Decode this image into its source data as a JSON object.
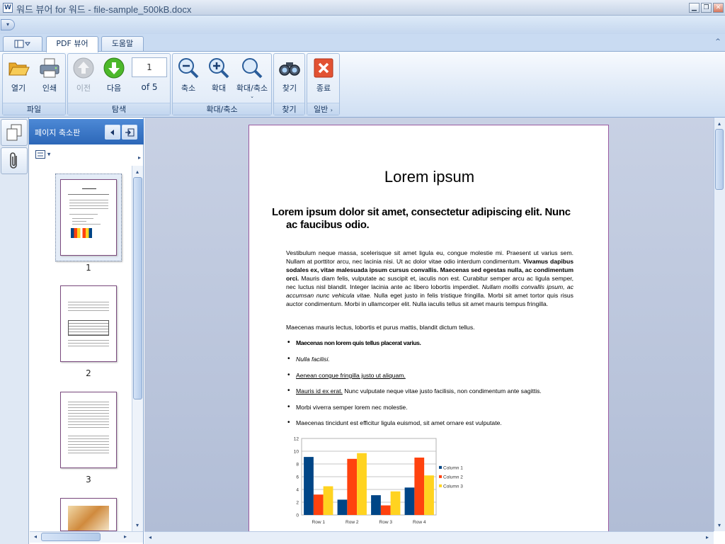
{
  "window": {
    "title": "워드 뷰어 for 워드 - file-sample_500kB.docx",
    "app_icon": "document-icon",
    "controls": [
      "minimize-icon",
      "restore-icon",
      "close-icon"
    ]
  },
  "tabs": [
    {
      "label": "PDF 뷰어",
      "active": true
    },
    {
      "label": "도움말",
      "active": false
    }
  ],
  "ribbon": {
    "groups": [
      {
        "label": "파일",
        "buttons": [
          {
            "label": "열기",
            "icon": "folder-open-icon"
          },
          {
            "label": "인쇄",
            "icon": "printer-icon"
          }
        ]
      },
      {
        "label": "탐색",
        "buttons": [
          {
            "label": "이전",
            "icon": "arrow-up-icon",
            "disabled": true
          },
          {
            "label": "다음",
            "icon": "arrow-down-icon"
          }
        ]
      },
      {
        "label": "확대/축소",
        "buttons": [
          {
            "label": "축소",
            "icon": "zoom-out-icon"
          },
          {
            "label": "확대",
            "icon": "zoom-in-icon"
          },
          {
            "label": "확대/축소",
            "icon": "zoom-icon"
          }
        ]
      },
      {
        "label": "찾기",
        "buttons": [
          {
            "label": "찾기",
            "icon": "binoculars-icon"
          }
        ]
      },
      {
        "label": "일반",
        "buttons": [
          {
            "label": "종료",
            "icon": "exit-icon"
          }
        ]
      }
    ],
    "page_number": "1",
    "page_of": "of 5"
  },
  "side_tabs": [
    "pages-icon",
    "paperclip-icon"
  ],
  "thumbnails": {
    "title": "페이지 축소판",
    "pages": [
      {
        "number": "1",
        "selected": true
      },
      {
        "number": "2",
        "selected": false
      },
      {
        "number": "3",
        "selected": false
      }
    ]
  },
  "document": {
    "title": "Lorem ipsum",
    "heading": "Lorem ipsum dolor sit amet, consectetur adipiscing elit. Nunc ac faucibus odio.",
    "paragraph_1a": "Vestibulum neque massa, scelerisque sit amet ligula eu, congue molestie mi. Praesent ut varius sem. Nullam at porttitor arcu, nec lacinia nisi. Ut ac dolor vitae odio interdum condimentum. ",
    "paragraph_1b": "Vivamus dapibus sodales ex, vitae malesuada ipsum cursus convallis. Maecenas sed egestas nulla, ac condimentum orci.",
    "paragraph_1c": " Mauris diam felis, vulputate ac suscipit et, iaculis non est. Curabitur semper arcu ac ligula semper, nec luctus nisl blandit. Integer lacinia ante ac libero lobortis imperdiet. ",
    "paragraph_1d": "Nullam mollis convallis ipsum, ac accumsan nunc vehicula vitae.",
    "paragraph_1e": " Nulla eget justo in felis tristique fringilla. Morbi sit amet tortor quis risus auctor condimentum. Morbi in ullamcorper elit. Nulla iaculis tellus sit amet mauris tempus fringilla.",
    "paragraph_2": "Maecenas mauris lectus, lobortis et purus mattis, blandit dictum tellus.",
    "bullets": [
      "Maecenas non lorem quis tellus placerat varius.",
      "Nulla facilisi.",
      "Aenean congue fringilla justo ut aliquam.",
      "Mauris id ex erat.",
      "Morbi viverra semper lorem nec molestie.",
      "Maecenas tincidunt est efficitur ligula euismod, sit amet ornare est vulputate."
    ],
    "bullet_4_rest": " Nunc vulputate neque vitae justo facilisis, non condimentum ante sagittis."
  },
  "chart_data": {
    "type": "bar",
    "categories": [
      "Row 1",
      "Row 2",
      "Row 3",
      "Row 4"
    ],
    "series": [
      {
        "name": "Column 1",
        "values": [
          9.1,
          2.4,
          3.1,
          4.3
        ],
        "color": "#004586"
      },
      {
        "name": "Column 2",
        "values": [
          3.2,
          8.8,
          1.5,
          9.0
        ],
        "color": "#ff420e"
      },
      {
        "name": "Column 3",
        "values": [
          4.5,
          9.7,
          3.7,
          6.2
        ],
        "color": "#ffd320"
      }
    ],
    "ylim": [
      0,
      12
    ],
    "yticks": [
      "0",
      "2",
      "4",
      "6",
      "8",
      "10",
      "12"
    ],
    "grid": true,
    "legend": "right"
  }
}
